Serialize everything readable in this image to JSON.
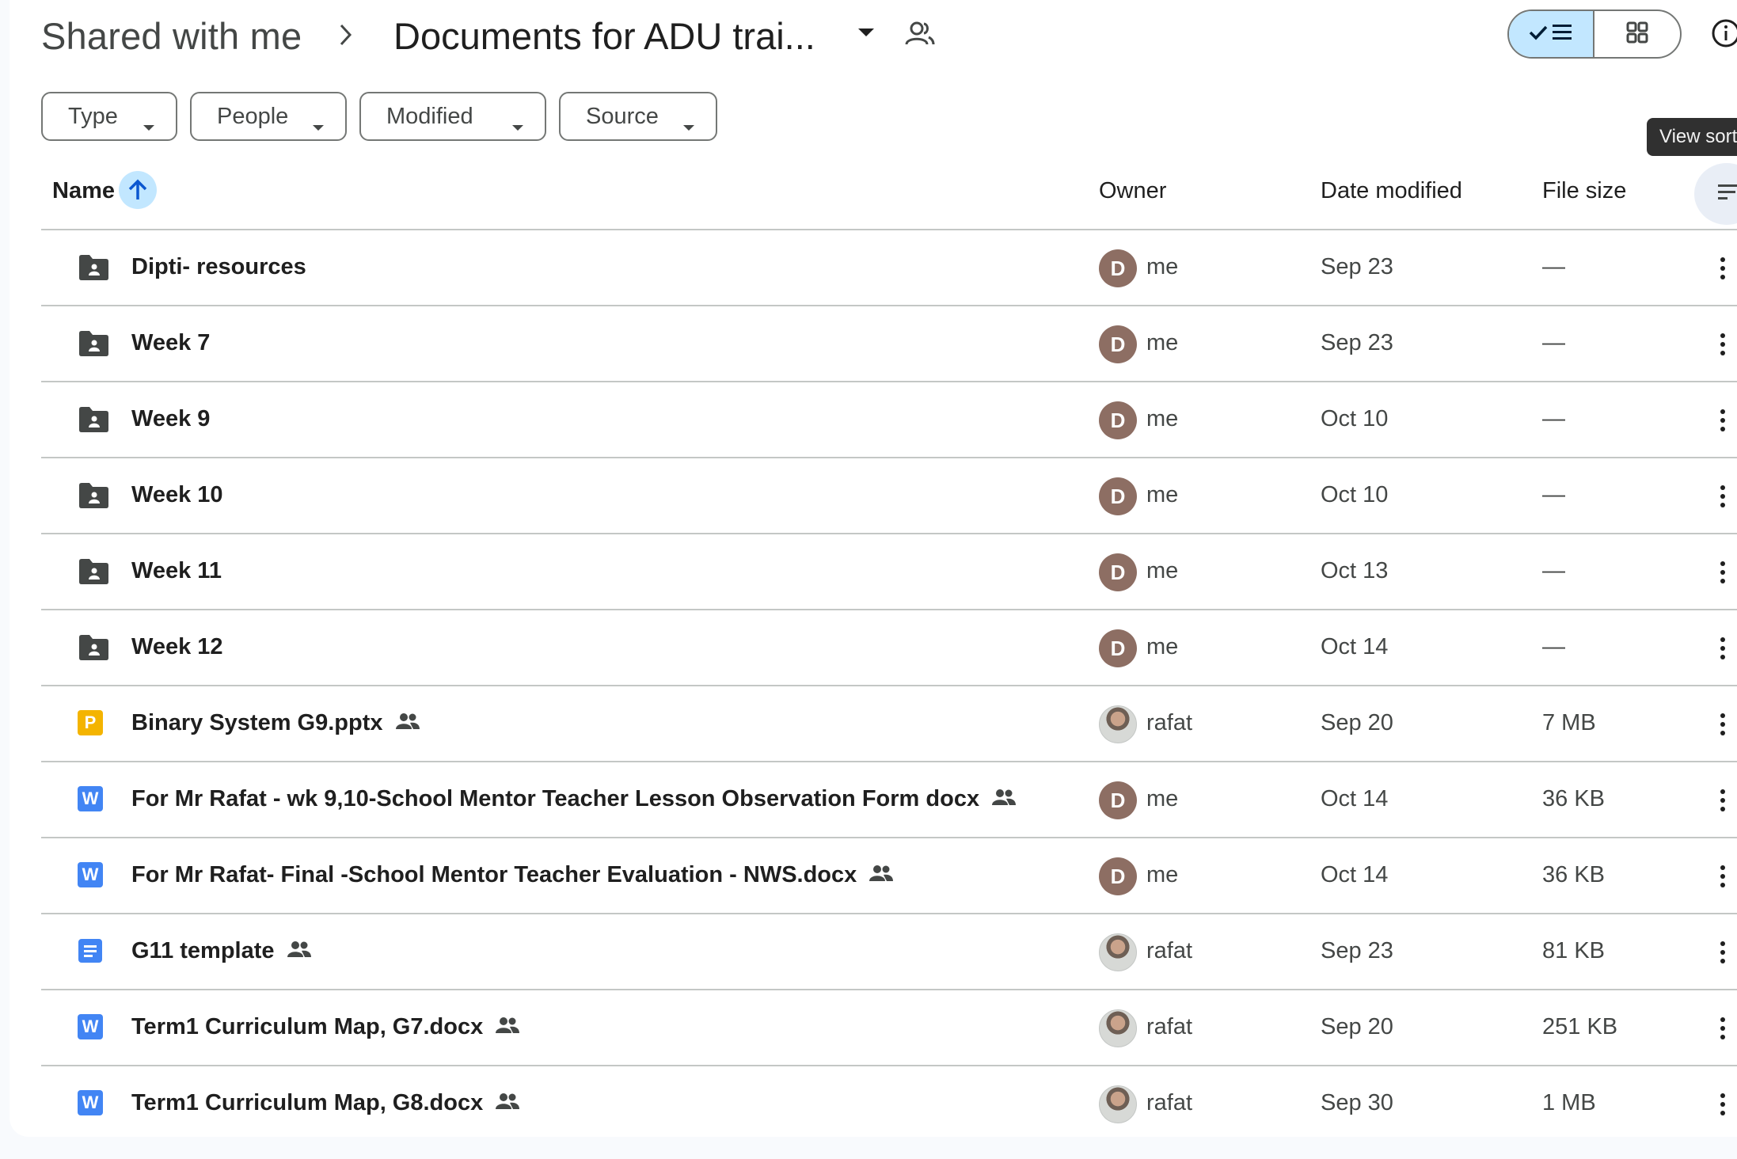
{
  "breadcrumb": {
    "root": "Shared with me",
    "current": "Documents for ADU trai..."
  },
  "view_toggle": {
    "list_selected": true,
    "list_icon": "check-list-icon",
    "grid_icon": "grid-icon"
  },
  "info_icon": "info-icon",
  "filters": [
    {
      "label": "Type"
    },
    {
      "label": "People"
    },
    {
      "label": "Modified"
    },
    {
      "label": "Source"
    }
  ],
  "tooltip": "View sort",
  "columns": {
    "name": "Name",
    "owner": "Owner",
    "date": "Date modified",
    "size": "File size"
  },
  "colors": {
    "accent": "#c2e7ff",
    "folder": "#444746",
    "slides": "#f4b400",
    "word": "#4285f4",
    "docs": "#4285f4",
    "avatar_me": "#8d6e63"
  },
  "rows": [
    {
      "icon": "shared-folder-icon",
      "name": "Dipti- resources",
      "shared": false,
      "avatar": "D",
      "owner": "me",
      "date": "Sep 23",
      "size": "—"
    },
    {
      "icon": "shared-folder-icon",
      "name": "Week 7",
      "shared": false,
      "avatar": "D",
      "owner": "me",
      "date": "Sep 23",
      "size": "—"
    },
    {
      "icon": "shared-folder-icon",
      "name": "Week 9",
      "shared": false,
      "avatar": "D",
      "owner": "me",
      "date": "Oct 10",
      "size": "—"
    },
    {
      "icon": "shared-folder-icon",
      "name": "Week 10",
      "shared": false,
      "avatar": "D",
      "owner": "me",
      "date": "Oct 10",
      "size": "—"
    },
    {
      "icon": "shared-folder-icon",
      "name": "Week 11",
      "shared": false,
      "avatar": "D",
      "owner": "me",
      "date": "Oct 13",
      "size": "—"
    },
    {
      "icon": "shared-folder-icon",
      "name": "Week 12",
      "shared": false,
      "avatar": "D",
      "owner": "me",
      "date": "Oct 14",
      "size": "—"
    },
    {
      "icon": "slides-file-icon",
      "badge": "P",
      "name": "Binary System G9.pptx",
      "shared": true,
      "avatar": "photo",
      "owner": "rafat",
      "date": "Sep 20",
      "size": "7 MB"
    },
    {
      "icon": "word-file-icon",
      "badge": "W",
      "name": "For Mr Rafat - wk 9,10-School Mentor Teacher Lesson Observation Form docx",
      "shared": true,
      "avatar": "D",
      "owner": "me",
      "date": "Oct 14",
      "size": "36 KB"
    },
    {
      "icon": "word-file-icon",
      "badge": "W",
      "name": "For Mr Rafat- Final -School Mentor Teacher Evaluation - NWS.docx",
      "shared": true,
      "avatar": "D",
      "owner": "me",
      "date": "Oct 14",
      "size": "36 KB"
    },
    {
      "icon": "google-docs-icon",
      "name": "G11 template",
      "shared": true,
      "avatar": "photo",
      "owner": "rafat",
      "date": "Sep 23",
      "size": "81 KB"
    },
    {
      "icon": "word-file-icon",
      "badge": "W",
      "name": "Term1 Curriculum Map, G7.docx",
      "shared": true,
      "avatar": "photo",
      "owner": "rafat",
      "date": "Sep 20",
      "size": "251 KB"
    },
    {
      "icon": "word-file-icon",
      "badge": "W",
      "name": "Term1 Curriculum Map, G8.docx",
      "shared": true,
      "avatar": "photo",
      "owner": "rafat",
      "date": "Sep 30",
      "size": "1 MB"
    }
  ]
}
